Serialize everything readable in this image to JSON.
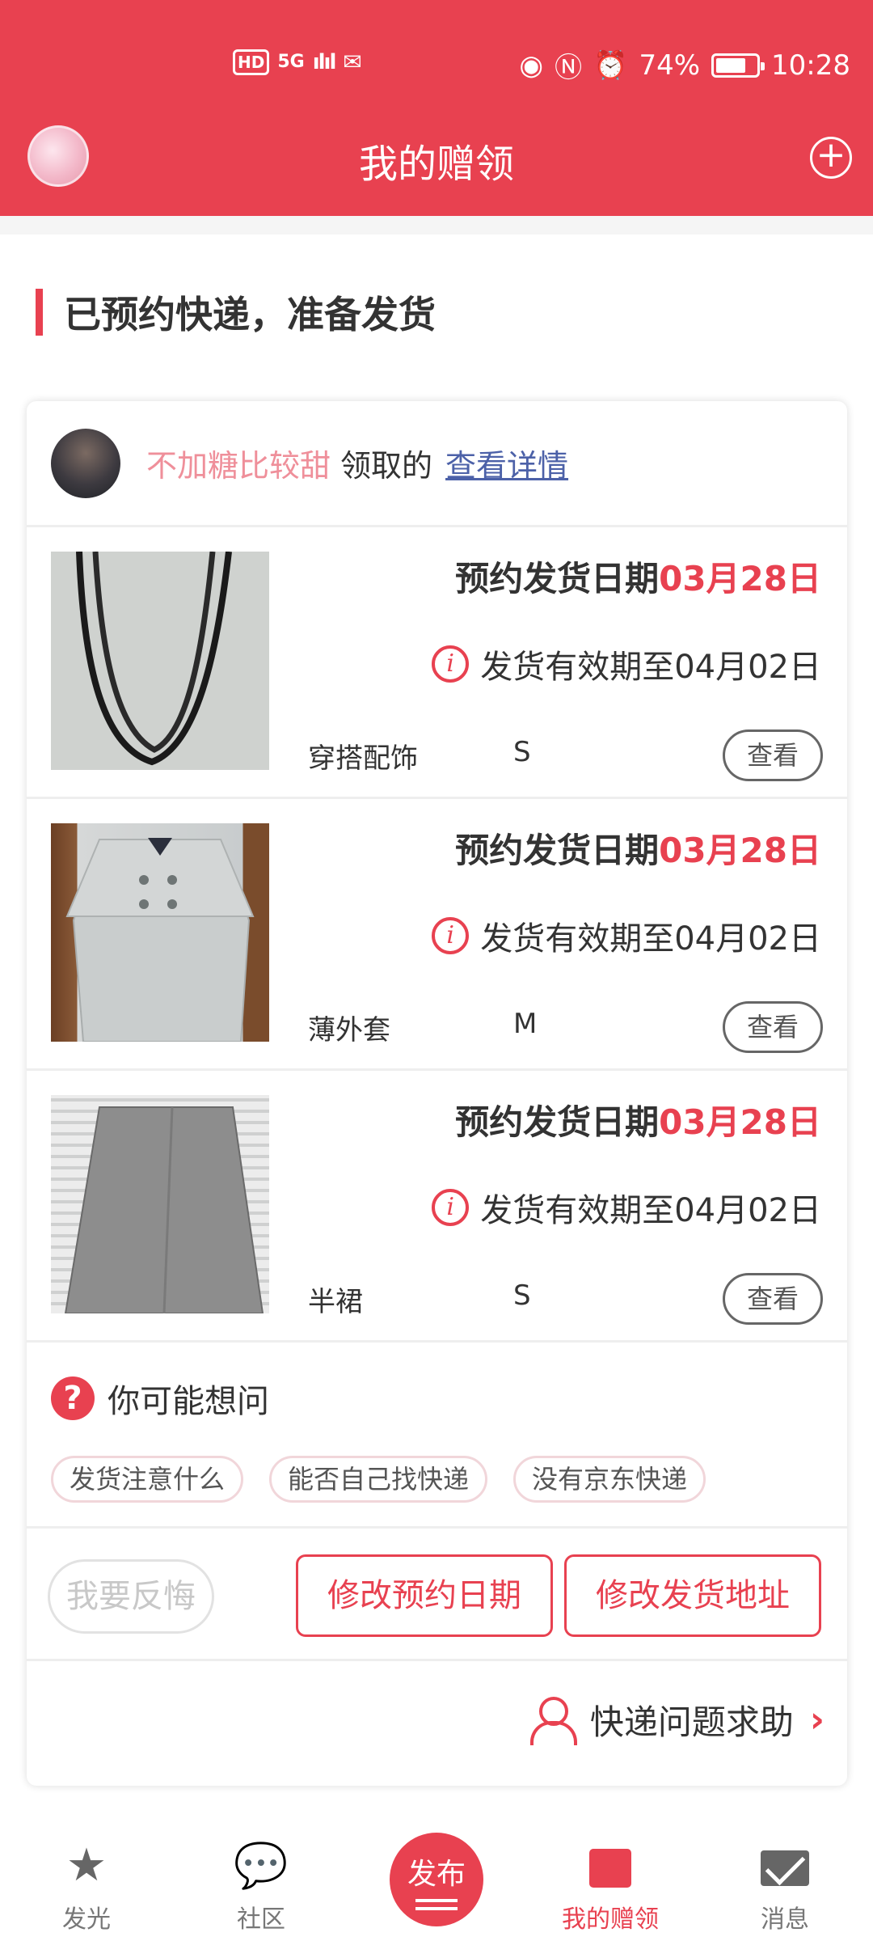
{
  "status_bar": {
    "hd": "HD",
    "net": "5G",
    "signal": "ılıl",
    "battery_pct": "74%",
    "battery_level": 0.74,
    "time": "10:28"
  },
  "nav": {
    "title": "我的赠领",
    "add_icon": "+"
  },
  "section": {
    "title": "已预约快递，准备发货"
  },
  "giver": {
    "name": "不加糖比较甜",
    "suffix": "领取的",
    "link": "查看详情"
  },
  "items": [
    {
      "date_label": "预约发货日期",
      "date_value": "03月28日",
      "valid_text": "发货有效期至04月02日",
      "category": "穿搭配饰",
      "size": "S",
      "view_label": "查看"
    },
    {
      "date_label": "预约发货日期",
      "date_value": "03月28日",
      "valid_text": "发货有效期至04月02日",
      "category": "薄外套",
      "size": "M",
      "view_label": "查看"
    },
    {
      "date_label": "预约发货日期",
      "date_value": "03月28日",
      "valid_text": "发货有效期至04月02日",
      "category": "半裙",
      "size": "S",
      "view_label": "查看"
    }
  ],
  "faq": {
    "title": "你可能想问",
    "chips": [
      "发货注意什么",
      "能否自己找快递",
      "没有京东快递"
    ]
  },
  "actions": {
    "regret": "我要反悔",
    "change_date": "修改预约日期",
    "change_address": "修改发货地址"
  },
  "help": {
    "label": "快递问题求助"
  },
  "tabbar": {
    "tabs": [
      {
        "label": "发光",
        "icon": "star-icon"
      },
      {
        "label": "社区",
        "icon": "chat-bubble-icon"
      },
      {
        "label": "发布",
        "icon": "publish-icon"
      },
      {
        "label": "我的赠领",
        "icon": "gift-icon"
      },
      {
        "label": "消息",
        "icon": "mail-icon"
      }
    ]
  },
  "colors": {
    "accent": "#e84150",
    "link": "#4c61a8",
    "giver_name": "#ef8f9a"
  }
}
